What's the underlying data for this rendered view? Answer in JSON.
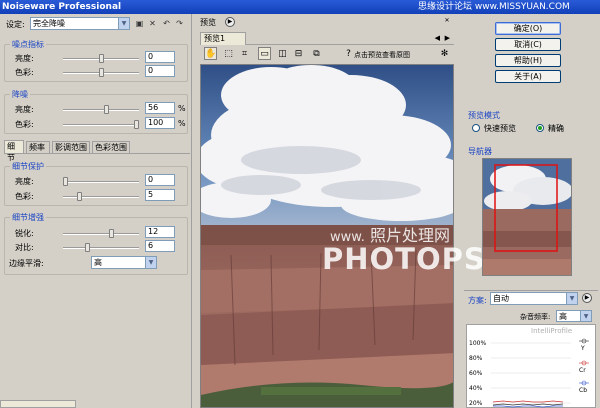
{
  "app": {
    "title": "Noiseware Professional",
    "watermark": "思缘设计论坛 www.MISSYUAN.COM",
    "overlay_watermark_cn": "照片处理网",
    "overlay_watermark_url": "www.",
    "overlay_watermark_brand": "PHOTOPS.COM"
  },
  "settings": {
    "label": "设定:",
    "preset_value": "完全降噪",
    "icons": [
      "save-icon",
      "delete-icon",
      "undo-icon",
      "redo-icon"
    ]
  },
  "noise_levels": {
    "title": "噪点指标",
    "fields": [
      {
        "label": "亮度:",
        "value": "0",
        "slider": 0.5
      },
      {
        "label": "色彩:",
        "value": "0",
        "slider": 0.5
      }
    ]
  },
  "noise_reduction": {
    "title": "降噪",
    "fields": [
      {
        "label": "亮度:",
        "value": "56",
        "unit": "%",
        "slider": 0.56
      },
      {
        "label": "色彩:",
        "value": "100",
        "unit": "%",
        "slider": 1.0
      }
    ]
  },
  "tabs": [
    "细节",
    "频率",
    "影调范围",
    "色彩范围"
  ],
  "detail_protection": {
    "title": "细节保护",
    "fields": [
      {
        "label": "亮度:",
        "value": "0",
        "slider": 0.0
      },
      {
        "label": "色彩:",
        "value": "5",
        "slider": 0.2
      }
    ]
  },
  "detail_enhance": {
    "title": "细节增强",
    "fields": [
      {
        "label": "锐化:",
        "value": "12",
        "slider": 0.64
      },
      {
        "label": "对比:",
        "value": "6",
        "slider": 0.32
      }
    ],
    "edge_label": "边缘平滑:",
    "edge_value": "高"
  },
  "preview": {
    "header": "预览",
    "tab": "预览1",
    "hint": "点击预览查看原图",
    "tools": [
      "hand-icon",
      "marquee-icon",
      "crop-icon",
      "single-view-icon",
      "split-vertical-icon",
      "split-horizontal-icon",
      "compare-icon",
      "help-icon"
    ]
  },
  "buttons": {
    "ok": "确定(O)",
    "cancel": "取消(C)",
    "help": "帮助(H)",
    "about": "关于(A)"
  },
  "preview_mode": {
    "title": "预览模式",
    "options": [
      "快速预览",
      "精确"
    ],
    "selected": 1
  },
  "navigator": {
    "title": "导航器"
  },
  "profile": {
    "label": "方案:",
    "value": "自动",
    "quality_label": "杂音频率:",
    "quality_value": "高",
    "graph_title": "IntelliProfile",
    "y_ticks": [
      "100%",
      "80%",
      "60%",
      "40%",
      "20%"
    ],
    "legend": [
      "Y",
      "Cr",
      "Cb"
    ],
    "legend_colors": [
      "#333333",
      "#cc3333",
      "#3355cc"
    ]
  }
}
